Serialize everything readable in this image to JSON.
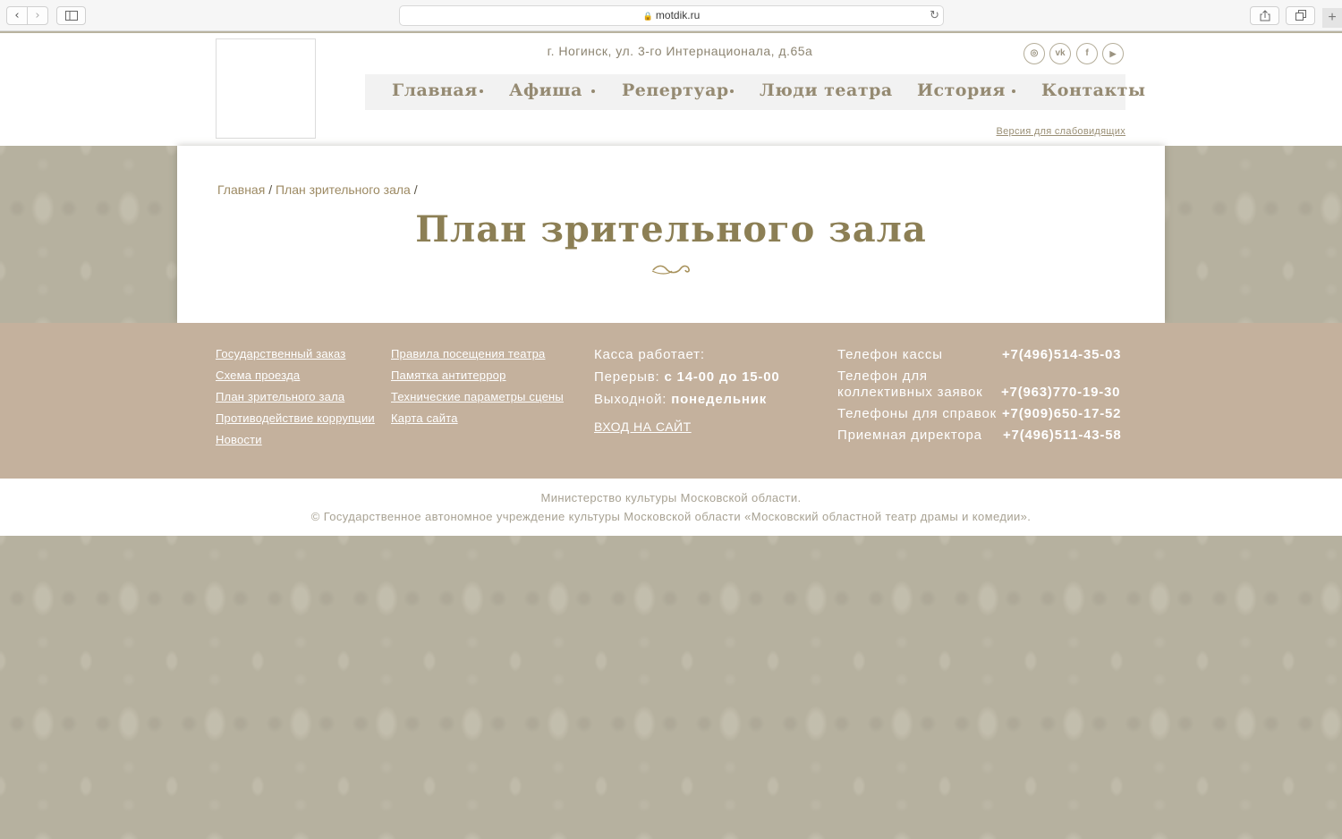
{
  "browser": {
    "url": "motdik.ru",
    "back_icon": "‹",
    "forward_icon": "›",
    "new_tab_icon": "+"
  },
  "header": {
    "address": "г. Ногинск, ул. 3-го Интернационала, д.65а",
    "social": [
      {
        "name": "instagram-icon",
        "glyph": "◎"
      },
      {
        "name": "vk-icon",
        "glyph": "vk"
      },
      {
        "name": "facebook-icon",
        "glyph": "f"
      },
      {
        "name": "youtube-icon",
        "glyph": "▶"
      }
    ],
    "nav": [
      "Главная",
      "Афиша",
      "Репертуар",
      "Люди театра",
      "История",
      "Контакты"
    ],
    "low_vision": "Версия для слабовидящих"
  },
  "breadcrumb": {
    "home": "Главная",
    "sep1": "/",
    "current": "План зрительного зала",
    "sep2": "/"
  },
  "page_title": "План зрительного зала",
  "footer": {
    "links_col1": [
      "Государственный заказ",
      "Схема проезда",
      "План зрительного зала",
      "Противодействие коррупции",
      "Новости"
    ],
    "links_col2": [
      "Правила посещения театра",
      "Памятка антитеррор",
      "Технические параметры сцены",
      "Карта сайта"
    ],
    "box_office": {
      "heading": "Касса работает:",
      "break_label": "Перерыв:",
      "break_value": "с 14-00 до 15-00",
      "dayoff_label": "Выходной:",
      "dayoff_value": "понедельник"
    },
    "login": "ВХОД НА САЙТ",
    "phones": {
      "box_label": "Телефон кассы",
      "box_value": "+7(496)514-35-03",
      "group_label_1": "Телефон для",
      "group_label_2": "коллективных заявок",
      "group_value": "+7(963)770-19-30",
      "info_label": "Телефоны для справок",
      "info_value": "+7(909)650-17-52",
      "director_label": "Приемная директора",
      "director_value": "+7(496)511-43-58"
    }
  },
  "copyright": {
    "line1": "Министерство культуры Московской области.",
    "line2": "© Государственное автономное учреждение культуры Московской области «Московский областной театр драмы и комедии»."
  }
}
